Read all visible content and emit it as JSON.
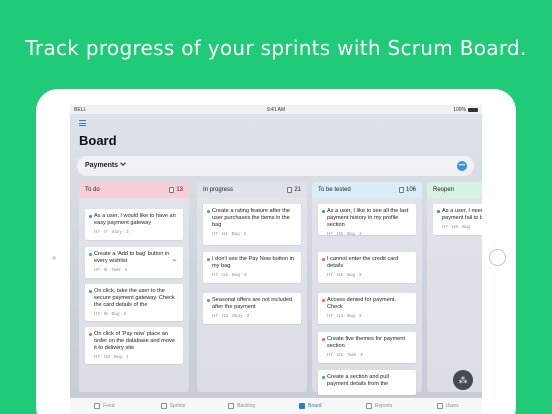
{
  "headline": "Track progress of your sprints with Scrum Board.",
  "status": {
    "carrier": "BELL",
    "time": "9:41 AM",
    "battery": "100%"
  },
  "board": {
    "title": "Board",
    "project": "Payments"
  },
  "columns": [
    {
      "title": "To do",
      "count": "13",
      "color": "#f7cfd8",
      "cards": [
        {
          "text": "As a user, I would like to have an easy payment gateway",
          "meta": "H7 · I7 · Story · 3",
          "dot": "#3a8fe8"
        },
        {
          "text": "Create a 'Add to bag' button in every wishlist",
          "meta": "H7 · I8 · Task · 3",
          "dot": "#2fbf71"
        },
        {
          "text": "On click, take the user to the secure payment gateway. Check the card details of the",
          "meta": "H7 · I9 · Bug · 3",
          "dot": "#2fbf71"
        },
        {
          "text": "On click of 'Pay now' place an order on the database and move it to delivery site",
          "meta": "H7 · I10 · Bug · 1",
          "dot": "#f06a4f"
        }
      ]
    },
    {
      "title": "In progress",
      "count": "21",
      "color": "#dfe2e7",
      "cards": [
        {
          "text": "Create a rating feature after the user purchases the items in the bag",
          "meta": "H7 · I11 · Bug · 3",
          "dot": "#2fbf71"
        },
        {
          "text": "I don't see the Pay Now button in my bag",
          "meta": "H7 · I12 · Bug · 3",
          "dot": "#f06a4f"
        },
        {
          "text": "Seasonal offers are not included after the payment",
          "meta": "H7 · I13 · Story · 3",
          "dot": "#f06a4f"
        }
      ]
    },
    {
      "title": "To be tested",
      "count": "106",
      "color": "#d9eef8",
      "cards": [
        {
          "text": "As a user, I like to see all the last payment history in my profile section",
          "meta": "H7 · I15 · Bug · 3",
          "dot": "#3a8fe8"
        },
        {
          "text": "I cannot enter the credit card details",
          "meta": "H7 · I16 · Bug · 3",
          "dot": "#f06a4f"
        },
        {
          "text": "Access denied for payment. Check",
          "meta": "H7 · I14 · Bug · 3",
          "dot": "#f06a4f"
        },
        {
          "text": "Create five themes for payment section",
          "meta": "H7 · I13 · Task · 3",
          "dot": "#f06a4f"
        },
        {
          "text": "Create a section and pull payment details from the",
          "meta": "",
          "dot": "#2fbf71"
        }
      ]
    },
    {
      "title": "Reopen",
      "count": "",
      "color": "#d6f2e2",
      "cards": [
        {
          "text": "As a user, I need box if my payment fail to be displ",
          "meta": "H7 · I18 · Bug",
          "dot": "#3a8fe8"
        }
      ]
    }
  ],
  "tabs": [
    {
      "label": "Feed",
      "active": false
    },
    {
      "label": "Sprints",
      "active": false
    },
    {
      "label": "Backlog",
      "active": false
    },
    {
      "label": "Board",
      "active": true
    },
    {
      "label": "Reports",
      "active": false
    },
    {
      "label": "Users",
      "active": false
    }
  ],
  "colors": {
    "background": "#1fcb77",
    "accent": "#2b79d6"
  }
}
